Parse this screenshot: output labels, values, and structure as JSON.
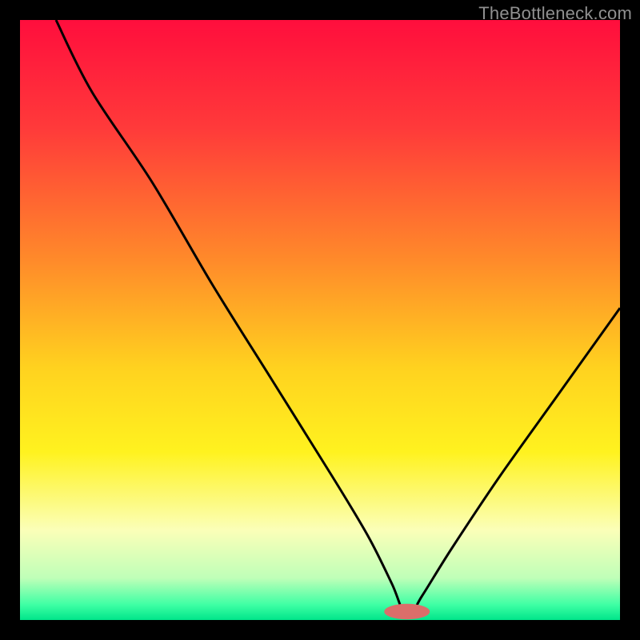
{
  "watermark": "TheBottleneck.com",
  "colors": {
    "frame": "#000000",
    "watermark": "#909090",
    "curve": "#000000",
    "marker_fill": "#db6e6a",
    "gradient_stops": [
      {
        "offset": 0.0,
        "color": "#ff0e3d"
      },
      {
        "offset": 0.18,
        "color": "#ff3a3a"
      },
      {
        "offset": 0.4,
        "color": "#ff8a2a"
      },
      {
        "offset": 0.58,
        "color": "#ffd21f"
      },
      {
        "offset": 0.72,
        "color": "#fff21f"
      },
      {
        "offset": 0.85,
        "color": "#fbffb8"
      },
      {
        "offset": 0.93,
        "color": "#bfffb8"
      },
      {
        "offset": 0.975,
        "color": "#3dffa4"
      },
      {
        "offset": 1.0,
        "color": "#00e58a"
      }
    ]
  },
  "chart_data": {
    "type": "line",
    "title": "",
    "xlabel": "",
    "ylabel": "",
    "xlim": [
      0,
      100
    ],
    "ylim": [
      0,
      100
    ],
    "grid": false,
    "legend": false,
    "series": [
      {
        "name": "bottleneck-curve",
        "x": [
          6,
          12,
          22,
          32,
          42,
          52,
          58,
          62,
          64.5,
          67,
          72,
          80,
          90,
          100
        ],
        "values": [
          100,
          88,
          73,
          56,
          40,
          24,
          14,
          6,
          0.5,
          4,
          12,
          24,
          38,
          52
        ]
      }
    ],
    "marker": {
      "x": 64.5,
      "y": 1.4,
      "rx": 3.8,
      "ry": 1.3
    }
  }
}
